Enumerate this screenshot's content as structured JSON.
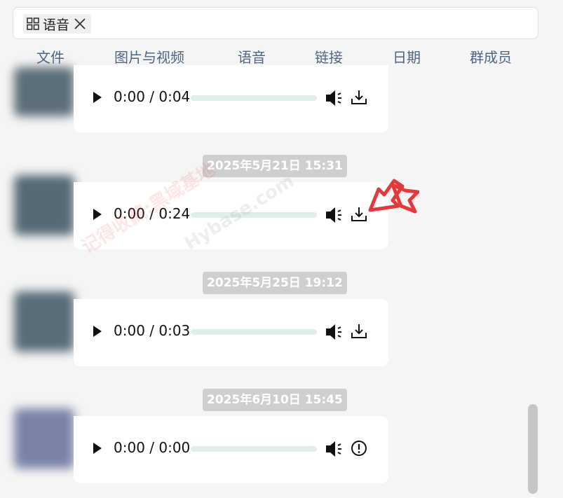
{
  "search": {
    "chip_label": "语音",
    "icon": "grid-icon",
    "close_icon": "close-icon"
  },
  "tabs": [
    {
      "label": "文件"
    },
    {
      "label": "图片与视频"
    },
    {
      "label": "语音"
    },
    {
      "label": "链接"
    },
    {
      "label": "日期"
    },
    {
      "label": "群成员"
    }
  ],
  "messages": [
    {
      "timestamp": "",
      "time_text": "0:00 / 0:04",
      "progress": 0,
      "action_icon": "download-icon"
    },
    {
      "timestamp": "2025年5月21日 15:31",
      "time_text": "0:00 / 0:24",
      "progress": 0,
      "action_icon": "download-icon"
    },
    {
      "timestamp": "2025年5月25日 19:12",
      "time_text": "0:00 / 0:03",
      "progress": 0,
      "action_icon": "download-icon"
    },
    {
      "timestamp": "2025年6月10日 15:45",
      "time_text": "0:00 / 0:00",
      "progress": 0,
      "action_icon": "error-icon"
    }
  ],
  "watermark": {
    "text_1": "记得收藏:黑域基地",
    "text_2": "Hybase.com"
  },
  "colors": {
    "tab_text": "#4f6584",
    "timestamp_bg": "#cfcfcf",
    "progress_track": "#deefe6",
    "arrow": "#e8373a"
  }
}
